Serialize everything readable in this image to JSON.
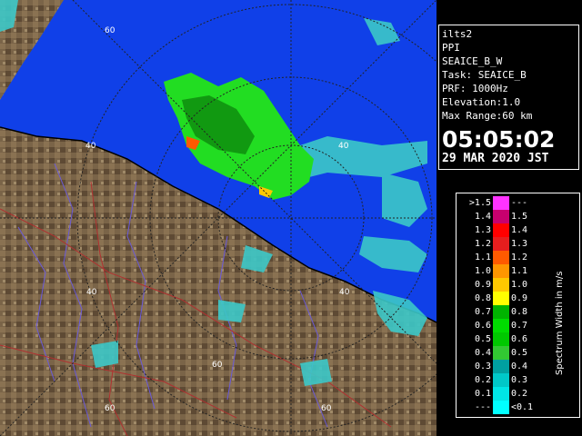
{
  "info": {
    "site": "ilts2",
    "product": "PPI",
    "scan": "SEAICE_B_W",
    "task": "Task: SEAICE_B",
    "prf": "PRF: 1000Hz",
    "elevation": "Elevation:1.0",
    "max_range": "Max Range:60 km",
    "time": "05:05:02",
    "date": "29 MAR 2020 JST"
  },
  "legend": {
    "unit": "Spectrum Width in m/s",
    "rows": [
      {
        "left": ">1.5",
        "right": "---",
        "color": "#ff33ff"
      },
      {
        "left": "1.4",
        "right": "1.5",
        "color": "#c8006e"
      },
      {
        "left": "1.3",
        "right": "1.4",
        "color": "#ff0000"
      },
      {
        "left": "1.2",
        "right": "1.3",
        "color": "#e61e1e"
      },
      {
        "left": "1.1",
        "right": "1.2",
        "color": "#ff5a00"
      },
      {
        "left": "1.0",
        "right": "1.1",
        "color": "#ff9600"
      },
      {
        "left": "0.9",
        "right": "1.0",
        "color": "#ffc800"
      },
      {
        "left": "0.8",
        "right": "0.9",
        "color": "#ffff00"
      },
      {
        "left": "0.7",
        "right": "0.8",
        "color": "#00b400"
      },
      {
        "left": "0.6",
        "right": "0.7",
        "color": "#00dc00"
      },
      {
        "left": "0.5",
        "right": "0.6",
        "color": "#00c800"
      },
      {
        "left": "0.4",
        "right": "0.5",
        "color": "#32c832"
      },
      {
        "left": "0.3",
        "right": "0.4",
        "color": "#00a0a0"
      },
      {
        "left": "0.2",
        "right": "0.3",
        "color": "#00c8c8"
      },
      {
        "left": "0.1",
        "right": "0.2",
        "color": "#00e6e6"
      },
      {
        "left": "---",
        "right": "<0.1",
        "color": "#00ffff"
      }
    ]
  },
  "map": {
    "ring_labels": [
      "60",
      "40",
      "40",
      "40",
      "40",
      "60",
      "60",
      "60"
    ],
    "colors": {
      "sea": "#1040e8",
      "land": "#7a6448",
      "echo_cyan": "#3cc8c8",
      "echo_green": "#22dd22",
      "grid": "#222222"
    }
  }
}
